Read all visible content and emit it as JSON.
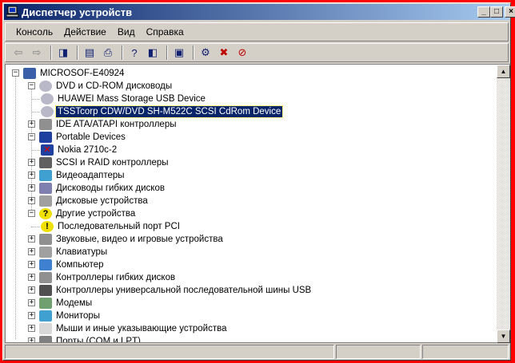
{
  "window": {
    "title": "Диспетчер устройств",
    "minimize": "_",
    "maximize": "□",
    "close": "×"
  },
  "menu": [
    "Консоль",
    "Действие",
    "Вид",
    "Справка"
  ],
  "toolbar": [
    {
      "name": "back-icon",
      "glyph": "⇦"
    },
    {
      "name": "forward-icon",
      "glyph": "⇨"
    },
    "sep",
    {
      "name": "show-hide-tree-icon",
      "glyph": "◨"
    },
    "sep",
    {
      "name": "properties-icon",
      "glyph": "▤"
    },
    {
      "name": "print-icon",
      "glyph": "⎙"
    },
    "sep",
    {
      "name": "help-icon",
      "glyph": "?"
    },
    {
      "name": "show-hide-action-pane-icon",
      "glyph": "◧"
    },
    "sep",
    {
      "name": "scan-hardware-icon",
      "glyph": "▣"
    },
    "sep",
    {
      "name": "update-driver-icon",
      "glyph": "⚙"
    },
    {
      "name": "uninstall-icon",
      "glyph": "✖"
    },
    {
      "name": "disable-icon",
      "glyph": "⊘"
    }
  ],
  "tree": [
    {
      "label": "MICROSOF-E40924",
      "level": 0,
      "exp": "-",
      "icon": "computer",
      "color": "#3a5ea8"
    },
    {
      "label": "DVD и CD-ROM дисководы",
      "level": 1,
      "exp": "-",
      "icon": "cdrom",
      "color": "#b8b8c8"
    },
    {
      "label": "HUAWEI Mass Storage USB Device",
      "level": 2,
      "exp": "",
      "icon": "cdrom",
      "color": "#b8b8c8"
    },
    {
      "label": "TSSTcorp CDW/DVD SH-M522C SCSI CdRom Device",
      "level": 2,
      "exp": "",
      "icon": "cdrom",
      "color": "#b8b8c8",
      "selected": true
    },
    {
      "label": "IDE ATA/ATAPI контроллеры",
      "level": 1,
      "exp": "+",
      "icon": "ide",
      "color": "#909090"
    },
    {
      "label": "Portable Devices",
      "level": 1,
      "exp": "-",
      "icon": "portable",
      "color": "#2040a0"
    },
    {
      "label": "Nokia 2710c-2",
      "level": 2,
      "exp": "",
      "icon": "device-error",
      "color": "#d02020"
    },
    {
      "label": "SCSI и RAID контроллеры",
      "level": 1,
      "exp": "+",
      "icon": "scsi",
      "color": "#606060"
    },
    {
      "label": "Видеоадаптеры",
      "level": 1,
      "exp": "+",
      "icon": "display",
      "color": "#40a0d0"
    },
    {
      "label": "Дисководы гибких дисков",
      "level": 1,
      "exp": "+",
      "icon": "floppy",
      "color": "#8080b0"
    },
    {
      "label": "Дисковые устройства",
      "level": 1,
      "exp": "+",
      "icon": "disk",
      "color": "#a0a0a0"
    },
    {
      "label": "Другие устройства",
      "level": 1,
      "exp": "-",
      "icon": "unknown",
      "color": "#f0e000"
    },
    {
      "label": "Последовательный порт PCI",
      "level": 2,
      "exp": "",
      "icon": "warning",
      "color": "#f0e000"
    },
    {
      "label": "Звуковые, видео и игровые устройства",
      "level": 1,
      "exp": "+",
      "icon": "sound",
      "color": "#909090"
    },
    {
      "label": "Клавиатуры",
      "level": 1,
      "exp": "+",
      "icon": "keyboard",
      "color": "#a0a0a0"
    },
    {
      "label": "Компьютер",
      "level": 1,
      "exp": "+",
      "icon": "computer",
      "color": "#4080d0"
    },
    {
      "label": "Контроллеры гибких дисков",
      "level": 1,
      "exp": "+",
      "icon": "controller",
      "color": "#909090"
    },
    {
      "label": "Контроллеры универсальной последовательной шины USB",
      "level": 1,
      "exp": "+",
      "icon": "usb",
      "color": "#505050"
    },
    {
      "label": "Модемы",
      "level": 1,
      "exp": "+",
      "icon": "modem",
      "color": "#70a070"
    },
    {
      "label": "Мониторы",
      "level": 1,
      "exp": "+",
      "icon": "monitor",
      "color": "#40a0d0"
    },
    {
      "label": "Мыши и иные указывающие устройства",
      "level": 1,
      "exp": "+",
      "icon": "mouse",
      "color": "#d8d8d8"
    },
    {
      "label": "Порты (COM и LPT)",
      "level": 1,
      "exp": "+",
      "icon": "port",
      "color": "#808080"
    }
  ],
  "selection_color": "#0a246a"
}
